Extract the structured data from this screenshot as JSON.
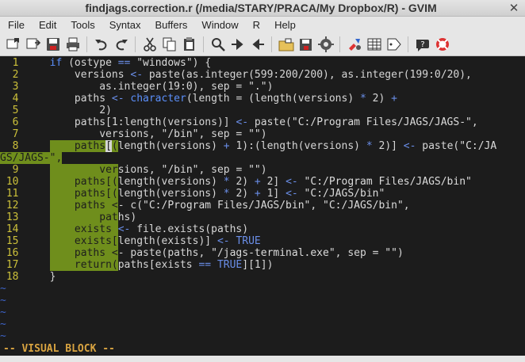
{
  "window": {
    "title": "findjags.correction.r (/media/STARY/PRACA/My Dropbox/R) - GVIM",
    "close_glyph": "✕"
  },
  "menu": [
    "File",
    "Edit",
    "Tools",
    "Syntax",
    "Buffers",
    "Window",
    "R",
    "Help"
  ],
  "toolbar": [
    {
      "name": "open-icon",
      "group": 0
    },
    {
      "name": "save-session-icon",
      "group": 0
    },
    {
      "name": "save-icon",
      "group": 0
    },
    {
      "name": "print-icon",
      "group": 0
    },
    {
      "name": "undo-icon",
      "group": 1
    },
    {
      "name": "redo-icon",
      "group": 1
    },
    {
      "name": "cut-icon",
      "group": 2
    },
    {
      "name": "copy-icon",
      "group": 2
    },
    {
      "name": "paste-icon",
      "group": 2
    },
    {
      "name": "find-icon",
      "group": 3
    },
    {
      "name": "find-next-icon",
      "group": 3
    },
    {
      "name": "find-prev-icon",
      "group": 3
    },
    {
      "name": "load-session-icon",
      "group": 4
    },
    {
      "name": "save-session-disk-icon",
      "group": 4
    },
    {
      "name": "run-script-icon",
      "group": 4
    },
    {
      "name": "make-icon",
      "group": 5
    },
    {
      "name": "shell-icon",
      "group": 5
    },
    {
      "name": "tags-icon",
      "group": 5
    },
    {
      "name": "help-icon",
      "group": 6
    },
    {
      "name": "find-help-icon",
      "group": 6
    }
  ],
  "colors": {
    "background": "#1c1c1c",
    "line_number": "#ccc03a",
    "keyword": "#5b8ffa",
    "visual_selection": "#6f8e1c",
    "status": "#d9a441",
    "tilde": "#3d63c8"
  },
  "editor": {
    "lines": [
      {
        "num": "1",
        "text": "    if (ostype == \"windows\") {"
      },
      {
        "num": "2",
        "text": "        versions <- paste(as.integer(599:200/200), as.integer(199:0/20),"
      },
      {
        "num": "3",
        "text": "            as.integer(19:0), sep = \".\")"
      },
      {
        "num": "4",
        "text": "        paths <- character(length = (length(versions) * 2) +"
      },
      {
        "num": "5",
        "text": "            2)"
      },
      {
        "num": "6",
        "text": "        paths[1:length(versions)] <- paste(\"C:/Program Files/JAGS/JAGS-\","
      },
      {
        "num": "7",
        "text": "            versions, \"/bin\", sep = \"\")"
      },
      {
        "num": "8",
        "text": "        paths[(length(versions) + 1):(length(versions) * 2)] <- paste(\"C:/JA"
      },
      {
        "num": "",
        "text": "GS/JAGS-\","
      },
      {
        "num": "9",
        "text": "            versions, \"/bin\", sep = \"\")"
      },
      {
        "num": "10",
        "text": "        paths[(length(versions) * 2) + 2] <- \"C:/Program Files/JAGS/bin\""
      },
      {
        "num": "11",
        "text": "        paths[(length(versions) * 2) + 1] <- \"C:/JAGS/bin\""
      },
      {
        "num": "12",
        "text": "        paths <- c(\"C:/Program Files/JAGS/bin\", \"C:/JAGS/bin\","
      },
      {
        "num": "13",
        "text": "            paths)"
      },
      {
        "num": "14",
        "text": "        exists <- file.exists(paths)"
      },
      {
        "num": "15",
        "text": "        exists[length(exists)] <- TRUE"
      },
      {
        "num": "16",
        "text": "        paths <- paste(paths, \"/jags-terminal.exe\", sep = \"\")"
      },
      {
        "num": "17",
        "text": "        return(paths[exists == TRUE][1])"
      },
      {
        "num": "18",
        "text": "    }"
      }
    ],
    "tildes": [
      "~",
      "~",
      "~",
      "~",
      "~",
      "~"
    ]
  },
  "status": {
    "mode": "-- VISUAL BLOCK --"
  }
}
